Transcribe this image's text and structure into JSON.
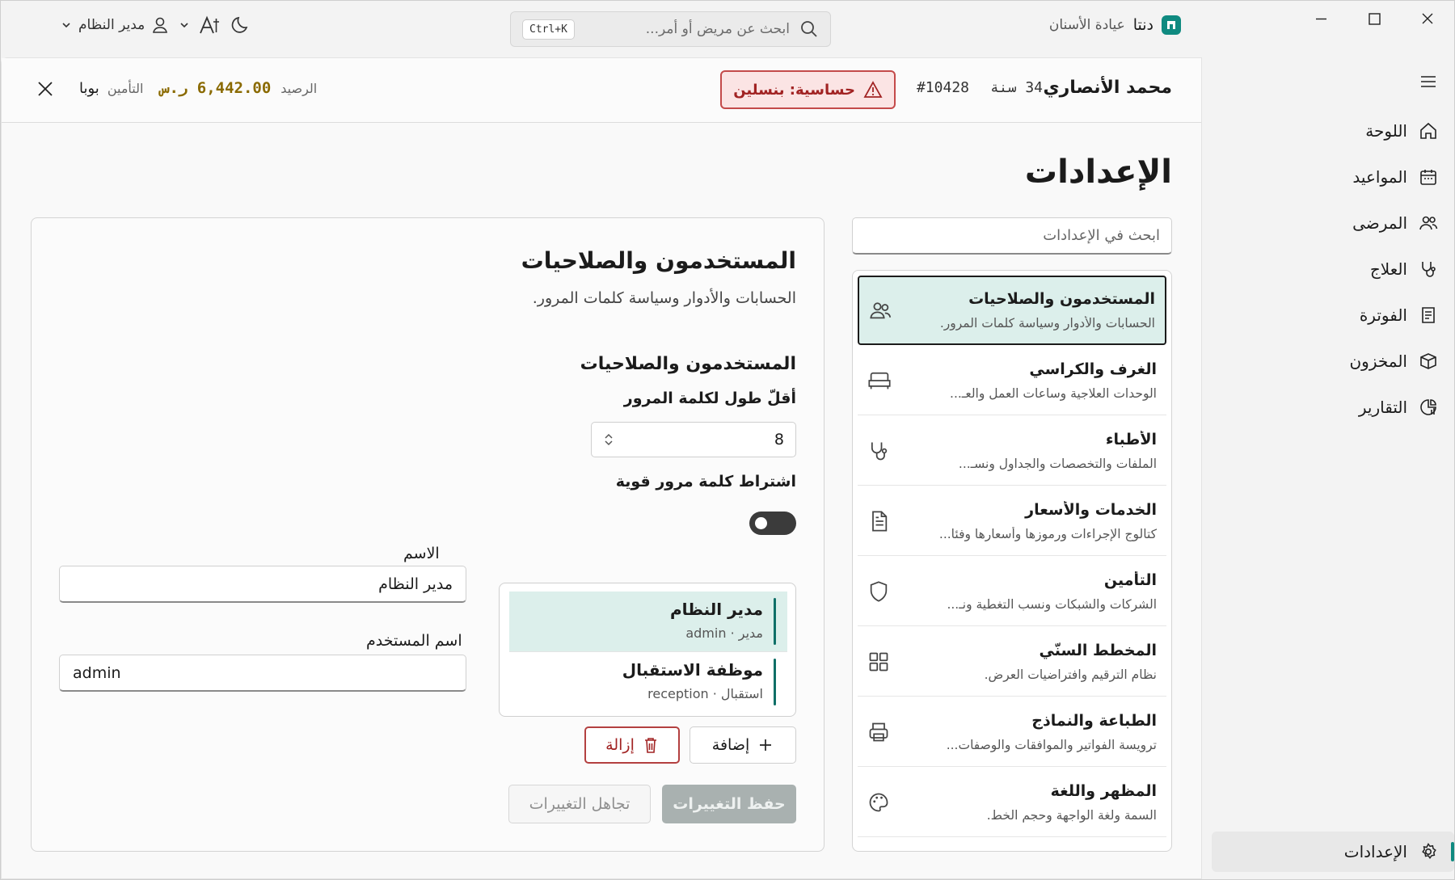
{
  "app": {
    "name": "دنتا",
    "subtitle": "عيادة الأسنان"
  },
  "titlebar": {
    "search_placeholder": "ابحث عن مريض أو أمر...",
    "search_shortcut": "Ctrl+K",
    "user_name": "مدير النظام"
  },
  "nav": {
    "items": [
      {
        "label": "اللوحة",
        "icon": "home-icon"
      },
      {
        "label": "المواعيد",
        "icon": "calendar-icon"
      },
      {
        "label": "المرضى",
        "icon": "users-icon"
      },
      {
        "label": "العلاج",
        "icon": "stethoscope-icon"
      },
      {
        "label": "الفوترة",
        "icon": "receipt-icon"
      },
      {
        "label": "المخزون",
        "icon": "box-icon"
      },
      {
        "label": "التقارير",
        "icon": "chart-icon"
      }
    ],
    "settings_label": "الإعدادات"
  },
  "patient": {
    "name": "محمد الأنصاري",
    "age": "34 سنة",
    "id": "#10428",
    "allergy": "حساسية: بنسلين",
    "balance_label": "الرصيد",
    "balance_value": "6,442.00 ر.س",
    "insurance_label": "التأمين",
    "insurance_value": "بوبا"
  },
  "page": {
    "title": "الإعدادات"
  },
  "settings": {
    "search_placeholder": "ابحث في الإعدادات",
    "items": [
      {
        "title": "المستخدمون والصلاحيات",
        "desc": "الحسابات والأدوار وسياسة كلمات المرور.",
        "icon": "users-icon"
      },
      {
        "title": "الغرف والكراسي",
        "desc": "الوحدات العلاجية وساعات العمل والعـ...",
        "icon": "bed-icon"
      },
      {
        "title": "الأطباء",
        "desc": "الملفات والتخصصات والجداول ونسـ...",
        "icon": "stethoscope-icon"
      },
      {
        "title": "الخدمات والأسعار",
        "desc": "كتالوج الإجراءات ورموزها وأسعارها وفئا...",
        "icon": "document-icon"
      },
      {
        "title": "التأمين",
        "desc": "الشركات والشبكات ونسب التغطية ونـ...",
        "icon": "shield-icon"
      },
      {
        "title": "المخطط السنّي",
        "desc": "نظام الترقيم وافتراضيات العرض.",
        "icon": "grid-icon"
      },
      {
        "title": "الطباعة والنماذج",
        "desc": "ترويسة الفواتير والموافقات والوصفات...",
        "icon": "printer-icon"
      },
      {
        "title": "المظهر واللغة",
        "desc": "السمة ولغة الواجهة وحجم الخط.",
        "icon": "palette-icon"
      }
    ]
  },
  "detail": {
    "title": "المستخدمون والصلاحيات",
    "subtitle": "الحسابات والأدوار وسياسة كلمات المرور.",
    "section_title": "المستخدمون والصلاحيات",
    "min_length_label": "أقلّ طول لكلمة المرور",
    "min_length_value": "8",
    "strong_password_label": "اشتراط كلمة مرور قوية",
    "strong_password_enabled": false,
    "users": [
      {
        "name": "مدير النظام",
        "desc": "مدير · admin"
      },
      {
        "name": "موظفة الاستقبال",
        "desc": "استقبال · reception"
      }
    ],
    "add_label": "إضافة",
    "remove_label": "إزالة",
    "name_label": "الاسم",
    "name_value": "مدير النظام",
    "username_label": "اسم المستخدم",
    "username_value": "admin",
    "save_label": "حفظ التغييرات",
    "discard_label": "تجاهل التغييرات"
  },
  "colors": {
    "accent": "#0f8a80",
    "danger": "#a12323",
    "balance": "#8a6a00"
  }
}
